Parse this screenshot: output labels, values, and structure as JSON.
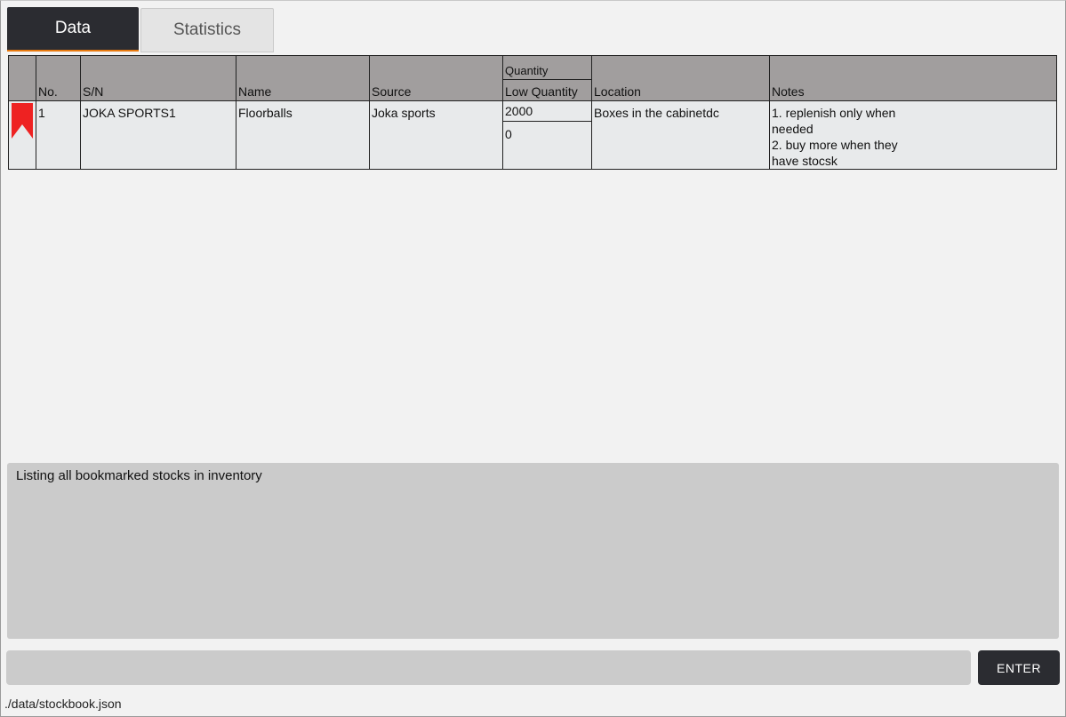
{
  "tabs": [
    {
      "label": "Data",
      "active": true
    },
    {
      "label": "Statistics",
      "active": false
    }
  ],
  "table": {
    "headers": {
      "no": "No.",
      "sn": "S/N",
      "name": "Name",
      "source": "Source",
      "quantity": "Quantity",
      "low_quantity": "Low Quantity",
      "location": "Location",
      "notes": "Notes"
    },
    "rows": [
      {
        "bookmarked": true,
        "no": "1",
        "sn": "JOKA SPORTS1",
        "name": "Floorballs",
        "source": "Joka sports",
        "quantity": "2000",
        "low_quantity": "0",
        "location": "Boxes in the cabinetdc",
        "notes_lines": [
          "1. replenish only when",
          "needed",
          "2. buy more when they",
          "have stocsk"
        ]
      }
    ]
  },
  "result_message": "Listing all bookmarked stocks in inventory",
  "command": {
    "value": "",
    "placeholder": ""
  },
  "enter_label": "ENTER",
  "status_path": "./data/stockbook.json",
  "colors": {
    "tab_active_bg": "#2b2c31",
    "tab_active_underline": "#e8790e",
    "header_bg": "#a19e9e",
    "row_bg": "#e8eaeb",
    "bookmark": "#ee2222",
    "panel_bg": "#cbcbcb"
  },
  "icons": {
    "bookmark": "bookmark-icon"
  }
}
